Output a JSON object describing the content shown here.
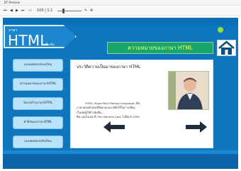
{
  "window": {
    "title": "BT Preview"
  },
  "toolbar": {
    "zoom_label": "100 | 1:1"
  },
  "header": {
    "logo_small": "ภาษา",
    "logo_big": "HTML",
    "logo_sub": "เบื้องต้น",
    "slide_title": "ความหมายของภาษา HTML"
  },
  "sidebar": {
    "items": [
      {
        "label": "แบบทดสอบก่อนเรียน"
      },
      {
        "label": "ความหมายของภาษาHTML"
      },
      {
        "label": "โครงสร้างภาษาHTML"
      },
      {
        "label": "คำสั่งของภาษาHTML"
      },
      {
        "label": "แบบทดสอบหลังเรียน"
      }
    ]
  },
  "content": {
    "heading": "ประวัติความเป็นมาของภาษา HTML",
    "body_line1": "HTML (HyperText Markup Language) คือ",
    "body_line2": "ภาษาคอมพิวเตอร์ที่ออกแบบมาเพื่อใช้ในการเขียน",
    "body_line3": "เว็บเพจผู้ให้กำเนิดคือ...",
    "body_line4": "ทิม เบอร์เนอส-ลี (Tim Berners-Lee) ในปีค.ศ.1990"
  },
  "colors": {
    "slide_blue": "#0f75bd",
    "title_green": "#1aa56b",
    "title_text": "#f7ff5a",
    "status_dot": "#8ee03e",
    "menu_button": "#b9e2fb"
  }
}
